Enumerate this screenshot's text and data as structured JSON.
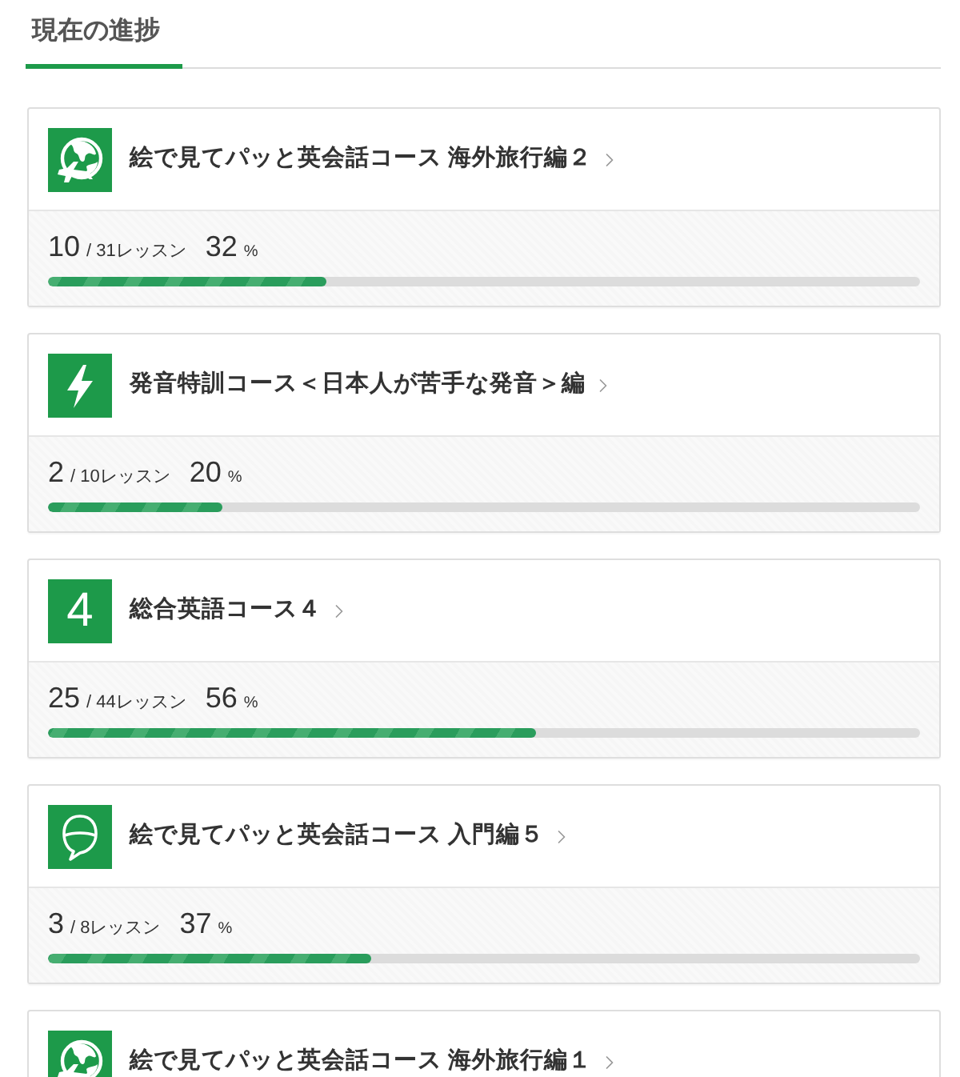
{
  "section": {
    "title": "現在の進捗",
    "selected": true
  },
  "courses": [
    {
      "icon": {
        "kind": "globe"
      },
      "title": "絵で見てパッと英会話コース 海外旅行編２",
      "progress": {
        "done": "10",
        "total": "/ 31レッスン",
        "percent": "32",
        "unit": "%",
        "level": 0.32
      }
    },
    {
      "icon": {
        "kind": "bolt"
      },
      "title": "発音特訓コース＜日本人が苦手な発音＞編",
      "progress": {
        "done": "2",
        "total": "/ 10レッスン",
        "percent": "20",
        "unit": "%",
        "level": 0.2
      }
    },
    {
      "icon": {
        "kind": "number",
        "label": "4"
      },
      "title": "総合英語コース４",
      "progress": {
        "done": "25",
        "total": "/ 44レッスン",
        "percent": "56",
        "unit": "%",
        "level": 0.56
      }
    },
    {
      "icon": {
        "kind": "bubble"
      },
      "title": "絵で見てパッと英会話コース 入門編５",
      "progress": {
        "done": "3",
        "total": "/ 8レッスン",
        "percent": "37",
        "unit": "%",
        "level": 0.37
      }
    },
    {
      "icon": {
        "kind": "globe"
      },
      "title": "絵で見てパッと英会話コース 海外旅行編１"
    }
  ]
}
